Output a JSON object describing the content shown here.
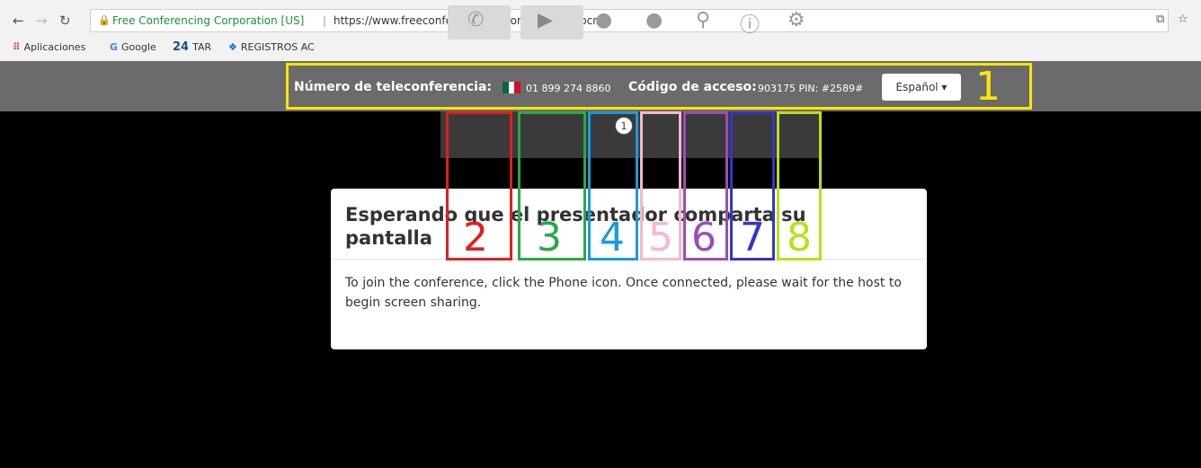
{
  "browser": {
    "site_name": "Free Conferencing Corporation [US]",
    "separator": "|",
    "url": "https://www.freeconferencecall.com/join/segopcnl",
    "bookmarks": [
      {
        "label": "Aplicaciones",
        "icon": "apps-grid-icon"
      },
      {
        "label": "Google",
        "icon": "google-icon"
      },
      {
        "label": "TAR",
        "icon": "number-24-icon"
      },
      {
        "label": "REGISTROS AC",
        "icon": "dropbox-icon"
      }
    ]
  },
  "conference": {
    "number_label": "Número de teleconferencia:",
    "number_value": "01 899 274 8860",
    "code_label": "Código de acceso:",
    "code_value": "903175 PIN: #2589#",
    "language": "Español ▾"
  },
  "toolbar": {
    "participant_count": "1",
    "icons": [
      "phone-icon",
      "video-icon",
      "participants-icon",
      "chat-icon",
      "search-icon",
      "info-icon",
      "settings-icon"
    ]
  },
  "annotations": [
    "1",
    "2",
    "3",
    "4",
    "5",
    "6",
    "7",
    "8"
  ],
  "annotation_colors": {
    "1": "#ffe600",
    "2": "#e02020",
    "3": "#2aa845",
    "4": "#1a9bdc",
    "5": "#f7b7cf",
    "6": "#9b4db5",
    "7": "#3535c8",
    "8": "#b6e21a"
  },
  "card": {
    "title": "Esperando que el presentador comparta su pantalla",
    "body": "To join the conference, click the Phone icon. Once connected, please wait for the host to begin screen sharing."
  }
}
